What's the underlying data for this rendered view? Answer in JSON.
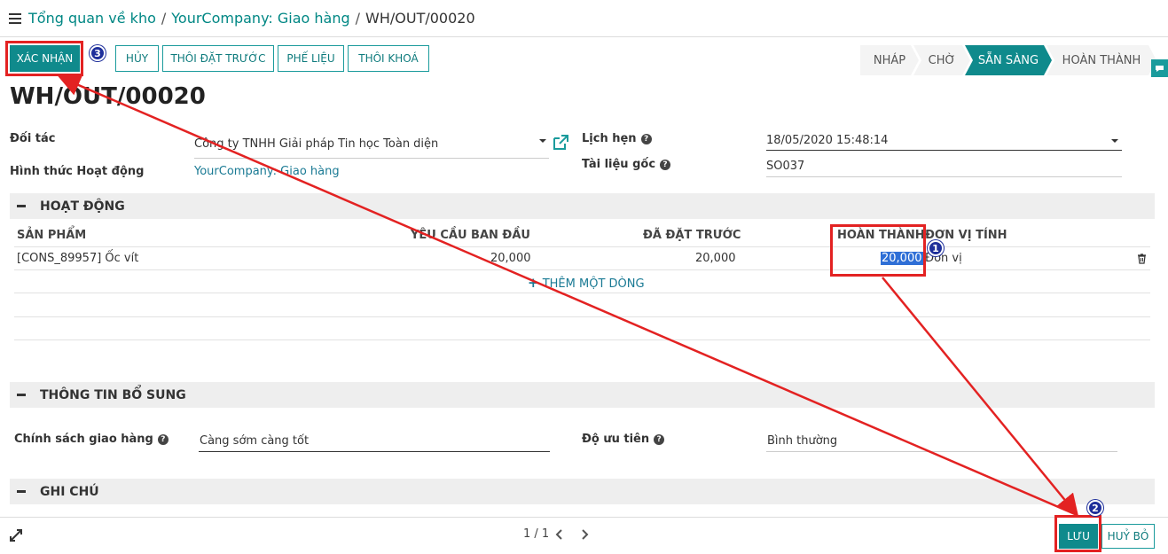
{
  "breadcrumb": {
    "item1": "Tổng quan về kho",
    "item2": "YourCompany: Giao hàng",
    "current": "WH/OUT/00020"
  },
  "toolbar": {
    "confirm": "XÁC NHẬN",
    "cancel": "HỦY",
    "unreserve": "THÔI ĐẶT TRƯỚC",
    "scrap": "PHẾ LIỆU",
    "unlock": "THÔI KHOÁ"
  },
  "stages": [
    "NHÁP",
    "CHỜ",
    "SẴN SÀNG",
    "HOÀN THÀNH"
  ],
  "active_stage": "SẴN SÀNG",
  "record_title": "WH/OUT/00020",
  "form": {
    "partner_label": "Đối tác",
    "partner_value": "Công ty TNHH Giải pháp Tin học Toàn diện",
    "operation_type_label": "Hình thức Hoạt động",
    "operation_type_value": "YourCompany: Giao hàng",
    "scheduled_label": "Lịch hẹn",
    "scheduled_value": "18/05/2020 15:48:14",
    "origin_label": "Tài liệu gốc",
    "origin_value": "SO037"
  },
  "operations": {
    "section_title": "HOẠT ĐỘNG",
    "columns": [
      "SẢN PHẨM",
      "YÊU CẦU BAN ĐẦU",
      "ĐÃ ĐẶT TRƯỚC",
      "HOÀN THÀNH",
      "ĐƠN VỊ TÍNH"
    ],
    "rows": [
      {
        "product": "[CONS_89957] Ốc vít",
        "initial_demand": "20,000",
        "reserved": "20,000",
        "done": "20,000",
        "uom": "Đơn vị"
      }
    ],
    "add_line": "THÊM MỘT DÒNG"
  },
  "additional_info": {
    "section_title": "THÔNG TIN BỔ SUNG",
    "shipping_policy_label": "Chính sách giao hàng",
    "shipping_policy_value": "Càng sớm càng tốt",
    "priority_label": "Độ ưu tiên",
    "priority_value": "Bình thường"
  },
  "notes": {
    "section_title": "GHI CHÚ"
  },
  "footer": {
    "pager": "1 / 1",
    "save": "LƯU",
    "discard": "HUỶ BỎ"
  },
  "annotations": {
    "badge1": "1",
    "badge2": "2",
    "badge3": "3",
    "color": "#e32222"
  }
}
